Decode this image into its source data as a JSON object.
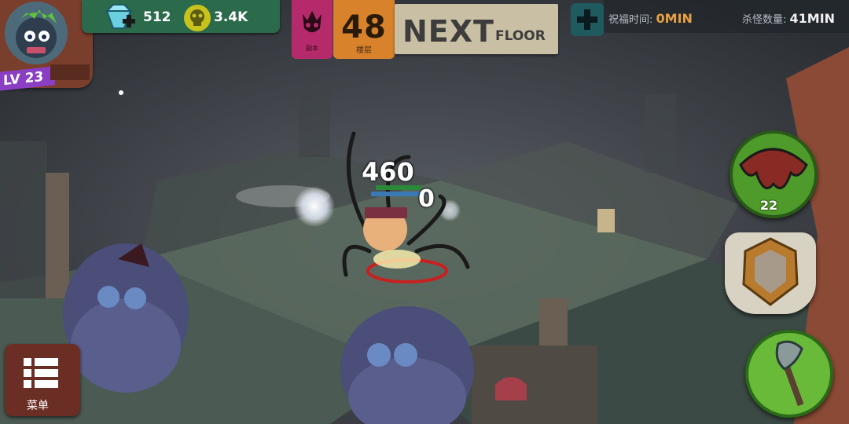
{
  "player": {
    "level_label": "LV 23"
  },
  "currency": {
    "gems": "512",
    "coins": "3.4K"
  },
  "boss": {
    "label": "副本"
  },
  "floor": {
    "number": "48",
    "label": "楼层"
  },
  "next_floor": {
    "next": "NEXT",
    "floor": "FLOOR"
  },
  "stats": {
    "blessing_label": "祝福时间:",
    "blessing_value": "0MIN",
    "kills_label": "杀怪数量:",
    "kills_value": "41MIN"
  },
  "combat": {
    "damage_big": "460",
    "damage_small": "0"
  },
  "skills": {
    "wings_count": "22"
  },
  "menu": {
    "label": "菜单"
  },
  "icons": [
    "gem-icon",
    "skull-coin-icon",
    "boss-skull-icon",
    "plus-icon",
    "wings-icon",
    "shield-icon",
    "axe-icon",
    "menu-grid-icon"
  ]
}
